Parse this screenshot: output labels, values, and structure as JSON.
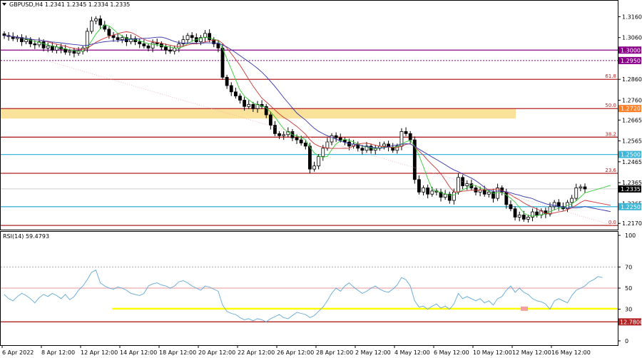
{
  "header": {
    "symbol_line": "GBPUSD,H4  1.2341 1.2345 1.2334 1.2335",
    "menu_icon": "triangle-down-icon"
  },
  "rsi_header": "RSI(14) 59.4793",
  "colors": {
    "bull_body": "#ffffff",
    "bear_body": "#000000",
    "ma_fast": "#33cc33",
    "ma_mid": "#cc3333",
    "ma_slow": "#3333aa",
    "level_red": "#b22222",
    "level_purple": "#8b008b",
    "level_cyan": "#3fb6d8",
    "zone_fill": "#fbe29a",
    "rsi_line": "#5fa8d8",
    "rsi_yellow": "#ffff00",
    "rsi_pink": "#f2b8b8",
    "rsi_marker": "#f0a0a0",
    "axis_text": "#000000"
  },
  "chart_data": [
    {
      "type": "candlestick",
      "title": "GBPUSD,H4",
      "ohlc_last": {
        "open": 1.2341,
        "high": 1.2345,
        "low": 1.2334,
        "close": 1.2335
      },
      "current_price_label": "1.2335",
      "ylim": [
        1.214,
        1.324
      ],
      "y_ticks": [
        1.316,
        1.306,
        1.2955,
        1.286,
        1.276,
        1.2665,
        1.2565,
        1.2465,
        1.2365,
        1.2265,
        1.217
      ],
      "y_tick_labels": [
        "1.3160",
        "1.3060",
        "1.2955",
        "1.2860",
        "1.2760",
        "1.2665",
        "1.2565",
        "1.2465",
        "1.2365",
        "1.2265",
        "1.2170"
      ],
      "x_tick_labels": [
        "6 Apr 2022",
        "8 Apr 12:00",
        "12 Apr 12:00",
        "14 Apr 12:00",
        "18 Apr 12:00",
        "20 Apr 12:00",
        "22 Apr 12:00",
        "26 Apr 12:00",
        "28 Apr 12:00",
        "2 May 12:00",
        "4 May 12:00",
        "6 May 12:00",
        "10 May 12:00",
        "12 May 12:00",
        "16 May 12:00"
      ],
      "candles_closes": [
        1.307,
        1.3065,
        1.3055,
        1.306,
        1.304,
        1.305,
        1.303,
        1.3025,
        1.304,
        1.301,
        1.302,
        1.3,
        1.3015,
        1.3005,
        1.299,
        1.2995,
        1.2985,
        1.2995,
        1.301,
        1.309,
        1.314,
        1.315,
        1.312,
        1.31,
        1.307,
        1.306,
        1.305,
        1.306,
        1.304,
        1.3055,
        1.304,
        1.303,
        1.302,
        1.301,
        1.3035,
        1.303,
        1.3015,
        1.3,
        1.2995,
        1.301,
        1.303,
        1.305,
        1.307,
        1.306,
        1.304,
        1.306,
        1.308,
        1.305,
        1.303,
        1.301,
        1.287,
        1.283,
        1.28,
        1.278,
        1.276,
        1.273,
        1.274,
        1.272,
        1.274,
        1.273,
        1.269,
        1.264,
        1.26,
        1.259,
        1.2595,
        1.261,
        1.258,
        1.257,
        1.2555,
        1.254,
        1.243,
        1.2445,
        1.249,
        1.253,
        1.256,
        1.259,
        1.258,
        1.257,
        1.256,
        1.254,
        1.255,
        1.253,
        1.252,
        1.254,
        1.252,
        1.253,
        1.254,
        1.255,
        1.2535,
        1.252,
        1.254,
        1.261,
        1.26,
        1.257,
        1.238,
        1.232,
        1.234,
        1.231,
        1.2325,
        1.232,
        1.2295,
        1.231,
        1.228,
        1.232,
        1.239,
        1.235,
        1.236,
        1.234,
        1.232,
        1.233,
        1.231,
        1.232,
        1.229,
        1.234,
        1.232,
        1.226,
        1.224,
        1.22,
        1.221,
        1.219,
        1.22,
        1.2225,
        1.221,
        1.223,
        1.2215,
        1.225,
        1.227,
        1.225,
        1.224,
        1.227,
        1.229,
        1.234,
        1.2345,
        1.2335
      ],
      "levels": [
        {
          "price": 1.3,
          "label": "1.3000",
          "color": "#8b008b",
          "kind": "solid"
        },
        {
          "price": 1.295,
          "label": "1.2950",
          "color": "#8b008b",
          "kind": "dotted"
        },
        {
          "price": 1.286,
          "label": "61.8",
          "color": "#b22222",
          "kind": "solid"
        },
        {
          "price": 1.272,
          "label": "50.0",
          "color": "#b22222",
          "kind": "solid"
        },
        {
          "price": 1.2583,
          "label": "38.2",
          "color": "#b22222",
          "kind": "solid"
        },
        {
          "price": 1.25,
          "label": "1.2500",
          "color": "#3fb6d8",
          "kind": "solid"
        },
        {
          "price": 1.241,
          "label": "23.6",
          "color": "#b22222",
          "kind": "solid"
        },
        {
          "price": 1.225,
          "label": "1.2250",
          "color": "#3fb6d8",
          "kind": "solid"
        },
        {
          "price": 1.216,
          "label": "0.0",
          "color": "#b22222",
          "kind": "solid"
        }
      ],
      "price_badges": [
        {
          "label": "1.3000",
          "color": "#8b008b"
        },
        {
          "label": "1.2950",
          "color": "#8b008b"
        },
        {
          "label": "1.2720",
          "color": "#ff7f27"
        },
        {
          "label": "1.2500",
          "color": "#3fb6d8"
        },
        {
          "label": "1.2335",
          "color": "#000000"
        },
        {
          "label": "1.2250",
          "color": "#3fb6d8"
        }
      ],
      "zone": {
        "from": 1.2672,
        "to": 1.272,
        "color": "#fbe29a"
      }
    },
    {
      "type": "line",
      "title": "RSI(14) 59.4793",
      "ylim": [
        0,
        100
      ],
      "y_ticks": [
        100,
        70,
        50,
        30,
        0
      ],
      "y_tick_labels": [
        "100",
        "70",
        "50",
        "30",
        "0"
      ],
      "levels": [
        {
          "value": 70,
          "label": "70",
          "color": "#bbbbbb",
          "kind": "dotted"
        },
        {
          "value": 50,
          "label": "50",
          "color": "#f2b8b8",
          "kind": "solid"
        },
        {
          "value": 30.5,
          "label": "",
          "color": "#ffff00",
          "kind": "solid"
        },
        {
          "value": 18,
          "label": "12.7800",
          "color": "#b22222",
          "kind": "solid"
        }
      ],
      "values": [
        44,
        40,
        38,
        42,
        45,
        43,
        40,
        36,
        41,
        44,
        42,
        45,
        43,
        40,
        44,
        39,
        42,
        48,
        52,
        58,
        65,
        67,
        55,
        52,
        50,
        49,
        51,
        50,
        48,
        45,
        44,
        43,
        45,
        52,
        54,
        55,
        53,
        52,
        50,
        52,
        56,
        57,
        55,
        52,
        50,
        48,
        52,
        51,
        49,
        47,
        34,
        28,
        26,
        25,
        22,
        20,
        21,
        19,
        21,
        20,
        18,
        21,
        23,
        25,
        22,
        21,
        24,
        27,
        26,
        25,
        22,
        24,
        28,
        32,
        38,
        45,
        50,
        47,
        52,
        55,
        51,
        48,
        45,
        47,
        50,
        52,
        49,
        47,
        46,
        49,
        53,
        60,
        58,
        52,
        38,
        32,
        33,
        30,
        33,
        35,
        31,
        33,
        30,
        35,
        45,
        40,
        42,
        40,
        38,
        40,
        36,
        38,
        34,
        40,
        42,
        48,
        52,
        46,
        50,
        46,
        44,
        40,
        38,
        37,
        35,
        30,
        38,
        40,
        38,
        36,
        43,
        48,
        50,
        52,
        56,
        58,
        61,
        60
      ]
    }
  ]
}
